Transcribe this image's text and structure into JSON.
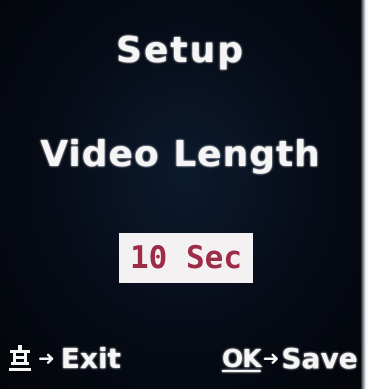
{
  "screen": {
    "title": "Setup",
    "setting_name": "Video Length",
    "setting_value": "10 Sec"
  },
  "footer": {
    "exit": {
      "key_icon": "gear-icon",
      "arrow": "➜",
      "label": "Exit"
    },
    "save": {
      "key_label": "OK",
      "arrow": "➜",
      "label": "Save"
    }
  },
  "colors": {
    "background": "#05080f",
    "text": "#f5f5f5",
    "value_box": "#f4f1f2",
    "value_text": "#9c2c47"
  }
}
